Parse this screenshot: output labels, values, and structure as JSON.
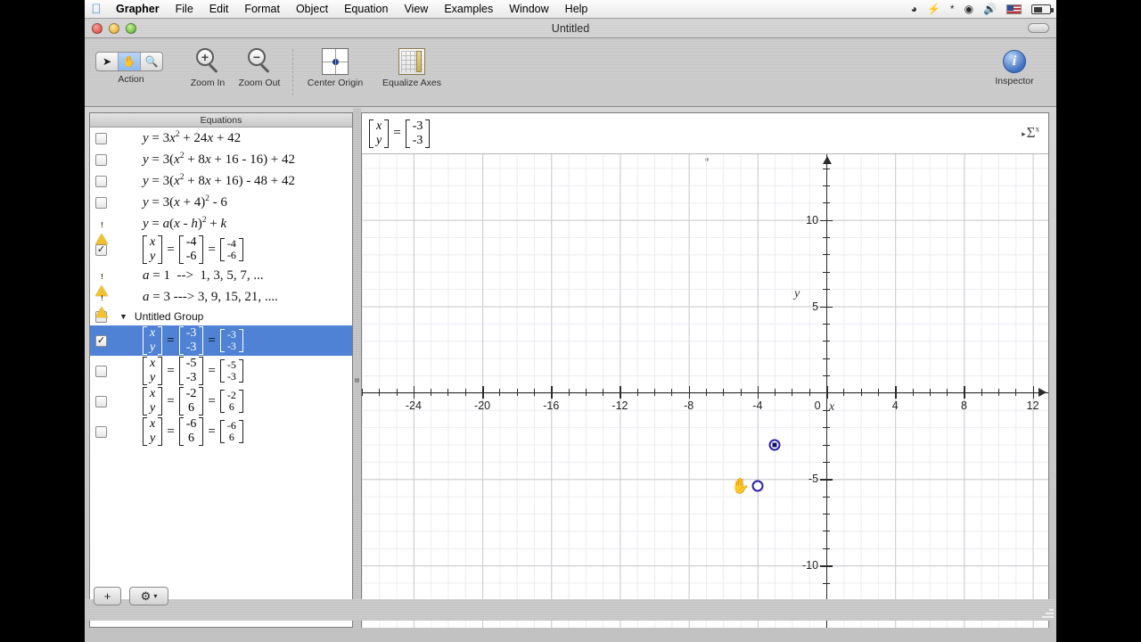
{
  "menubar": {
    "apple_icon": "apple-logo-icon",
    "items": [
      "Grapher",
      "File",
      "Edit",
      "Format",
      "Object",
      "Equation",
      "View",
      "Examples",
      "Window",
      "Help"
    ],
    "status_icons": [
      "spotlight-icon",
      "lightning-icon",
      "bluetooth-icon",
      "wifi-icon",
      "volume-icon",
      "keyboard-flag-icon",
      "battery-icon"
    ]
  },
  "window": {
    "title": "Untitled"
  },
  "toolbar": {
    "action_label": "Action",
    "action_segments": [
      "arrow-tool",
      "hand-tool",
      "zoom-tool"
    ],
    "action_selected": "hand-tool",
    "zoom_in_label": "Zoom In",
    "zoom_out_label": "Zoom Out",
    "center_origin_label": "Center Origin",
    "equalize_axes_label": "Equalize Axes",
    "inspector_label": "Inspector",
    "inspector_glyph": "i"
  },
  "equations_panel": {
    "header": "Equations",
    "rows": [
      {
        "kind": "expr",
        "state": "unchecked",
        "html": "<i>y</i> = 3<i>x</i><sup>2</sup> + 24<i>x</i> + 42"
      },
      {
        "kind": "expr",
        "state": "unchecked",
        "html": "<i>y</i> = 3(<i>x</i><sup>2</sup> + 8<i>x</i> + 16 - 16) + 42"
      },
      {
        "kind": "expr",
        "state": "unchecked",
        "html": "<i>y</i> = 3(<i>x</i><sup>2</sup> + 8<i>x</i> + 16) - 48 + 42"
      },
      {
        "kind": "expr",
        "state": "unchecked",
        "html": "<i>y</i> = 3(<i>x</i> + 4)<sup>2</sup> - 6"
      },
      {
        "kind": "expr",
        "state": "warning",
        "html": "<i>y</i> = <i>a</i>(<i>x</i> - <i>h</i>)<sup>2</sup> + <i>k</i>"
      },
      {
        "kind": "vector",
        "state": "checked",
        "lhs": [
          "x",
          "y"
        ],
        "mid": [
          "-4",
          "-6"
        ],
        "rhs": [
          "-4",
          "-6"
        ]
      },
      {
        "kind": "expr",
        "state": "warning",
        "html": "<i>a</i> = 1&nbsp; --&gt;&nbsp; 1, 3, 5, 7, ..."
      },
      {
        "kind": "expr",
        "state": "warning",
        "html": "<i>a</i> = 3 ---&gt; 3, 9, 15, 21, ...."
      },
      {
        "kind": "group",
        "state": "mixed",
        "label": "Untitled Group",
        "disclosure": "▼"
      },
      {
        "kind": "vector",
        "state": "checked",
        "selected": true,
        "lhs": [
          "x",
          "y"
        ],
        "mid": [
          "-3",
          "-3"
        ],
        "rhs": [
          "-3",
          "-3"
        ]
      },
      {
        "kind": "vector",
        "state": "unchecked",
        "lhs": [
          "x",
          "y"
        ],
        "mid": [
          "-5",
          "-3"
        ],
        "rhs": [
          "-5",
          "-3"
        ]
      },
      {
        "kind": "vector",
        "state": "unchecked",
        "lhs": [
          "x",
          "y"
        ],
        "mid": [
          "-2",
          "6"
        ],
        "rhs": [
          "-2",
          "6"
        ]
      },
      {
        "kind": "vector",
        "state": "unchecked",
        "lhs": [
          "x",
          "y"
        ],
        "mid": [
          "-6",
          "6"
        ],
        "rhs": [
          "-6",
          "6"
        ]
      }
    ]
  },
  "equation_bar": {
    "lhs": [
      "x",
      "y"
    ],
    "rhs": [
      "-3",
      "-3"
    ],
    "palette_icon": "sigma-palette-icon"
  },
  "bottom_bar": {
    "add_label": "+",
    "settings_glyph": "⚙",
    "settings_caret": "▾"
  },
  "chart_data": {
    "type": "scatter",
    "title": "",
    "xlabel": "x",
    "ylabel": "y",
    "xlim": [
      -27.0,
      12.9
    ],
    "ylim": [
      -13.6,
      13.8
    ],
    "x_major_ticks": [
      -24,
      -20,
      -16,
      -12,
      -8,
      -4,
      0,
      4,
      8,
      12
    ],
    "x_tick_labels": [
      "-24",
      "-20",
      "-16",
      "-12",
      "-8",
      "-4",
      "0",
      "4",
      "8",
      "12"
    ],
    "y_major_ticks": [
      -10,
      -5,
      5,
      10
    ],
    "y_tick_labels": [
      "-10",
      "-5",
      "5",
      "10"
    ],
    "x_minor_step": 1,
    "y_minor_step": 1,
    "grid": true,
    "grid_major_x_step": 4,
    "grid_major_y_step": 5,
    "legend": "none",
    "points": [
      {
        "label": "selected-point",
        "x": -3,
        "y": -3,
        "selected": true
      },
      {
        "label": "hovered-point",
        "x": -4,
        "y": -5.4,
        "selected": false
      }
    ],
    "cursor": {
      "type": "hand-cursor",
      "x": -5,
      "y": -5.4
    }
  }
}
